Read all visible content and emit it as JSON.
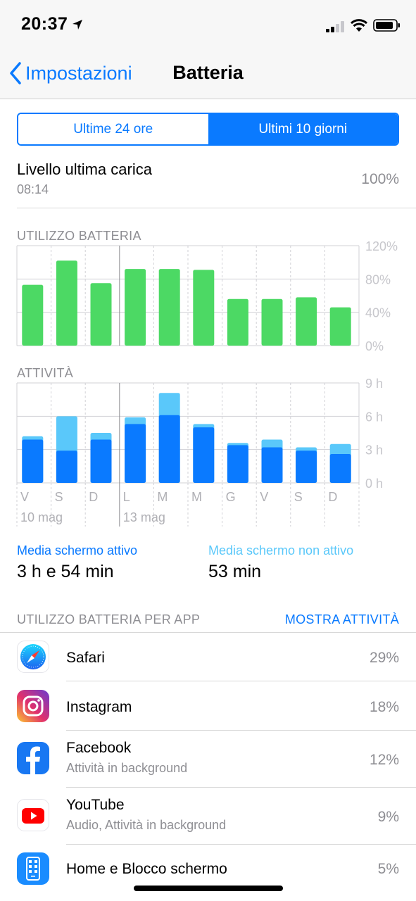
{
  "status": {
    "time": "20:37"
  },
  "nav": {
    "back_label": "Impostazioni",
    "title": "Batteria"
  },
  "segment": {
    "options": [
      "Ultime 24 ore",
      "Ultimi 10 giorni"
    ],
    "selected": 1
  },
  "last_charge": {
    "title": "Livello ultima carica",
    "time": "08:14",
    "value": "100%"
  },
  "colors": {
    "accent": "#0a7aff",
    "battery_green": "#4cd964",
    "screen_on": "#0a7aff",
    "screen_off": "#5ac8fa",
    "grid": "#d1d1d6",
    "secondary_text": "#8e8e93"
  },
  "chart_data": [
    {
      "type": "bar",
      "title": "UTILIZZO BATTERIA",
      "categories": [
        "V",
        "S",
        "D",
        "L",
        "M",
        "M",
        "G",
        "V",
        "S",
        "D"
      ],
      "values": [
        73,
        102,
        75,
        92,
        92,
        91,
        56,
        56,
        58,
        46
      ],
      "yticks": [
        "120%",
        "80%",
        "40%",
        "0%"
      ],
      "ylim": [
        0,
        120
      ],
      "grid": true
    },
    {
      "type": "bar",
      "title": "ATTIVITÀ",
      "categories": [
        "V",
        "S",
        "D",
        "L",
        "M",
        "M",
        "G",
        "V",
        "S",
        "D"
      ],
      "date_labels": [
        "10 mag",
        "13 mag"
      ],
      "series": [
        {
          "values": [
            3.9,
            2.9,
            3.9,
            5.3,
            6.1,
            5.0,
            3.4,
            3.2,
            2.9,
            2.6
          ]
        },
        {
          "values": [
            0.3,
            3.1,
            0.6,
            0.6,
            2.0,
            0.3,
            0.2,
            0.7,
            0.3,
            0.9
          ]
        }
      ],
      "yticks": [
        "9 h",
        "6 h",
        "3 h",
        "0 h"
      ],
      "ylim": [
        0,
        9
      ],
      "stacked": true,
      "grid": true
    }
  ],
  "averages": {
    "screen_on_label": "Media schermo attivo",
    "screen_on_value": "3 h e 54 min",
    "screen_off_label": "Media schermo non attivo",
    "screen_off_value": "53 min"
  },
  "per_app": {
    "title": "UTILIZZO BATTERIA PER APP",
    "action": "MOSTRA ATTIVITÀ",
    "apps": [
      {
        "name": "Safari",
        "sub": "",
        "pct": "29%",
        "icon": "safari-icon"
      },
      {
        "name": "Instagram",
        "sub": "",
        "pct": "18%",
        "icon": "instagram-icon"
      },
      {
        "name": "Facebook",
        "sub": "Attività in background",
        "pct": "12%",
        "icon": "facebook-icon"
      },
      {
        "name": "YouTube",
        "sub": "Audio, Attività in background",
        "pct": "9%",
        "icon": "youtube-icon"
      },
      {
        "name": "Home e Blocco schermo",
        "sub": "",
        "pct": "5%",
        "icon": "home-lock-icon"
      }
    ]
  }
}
